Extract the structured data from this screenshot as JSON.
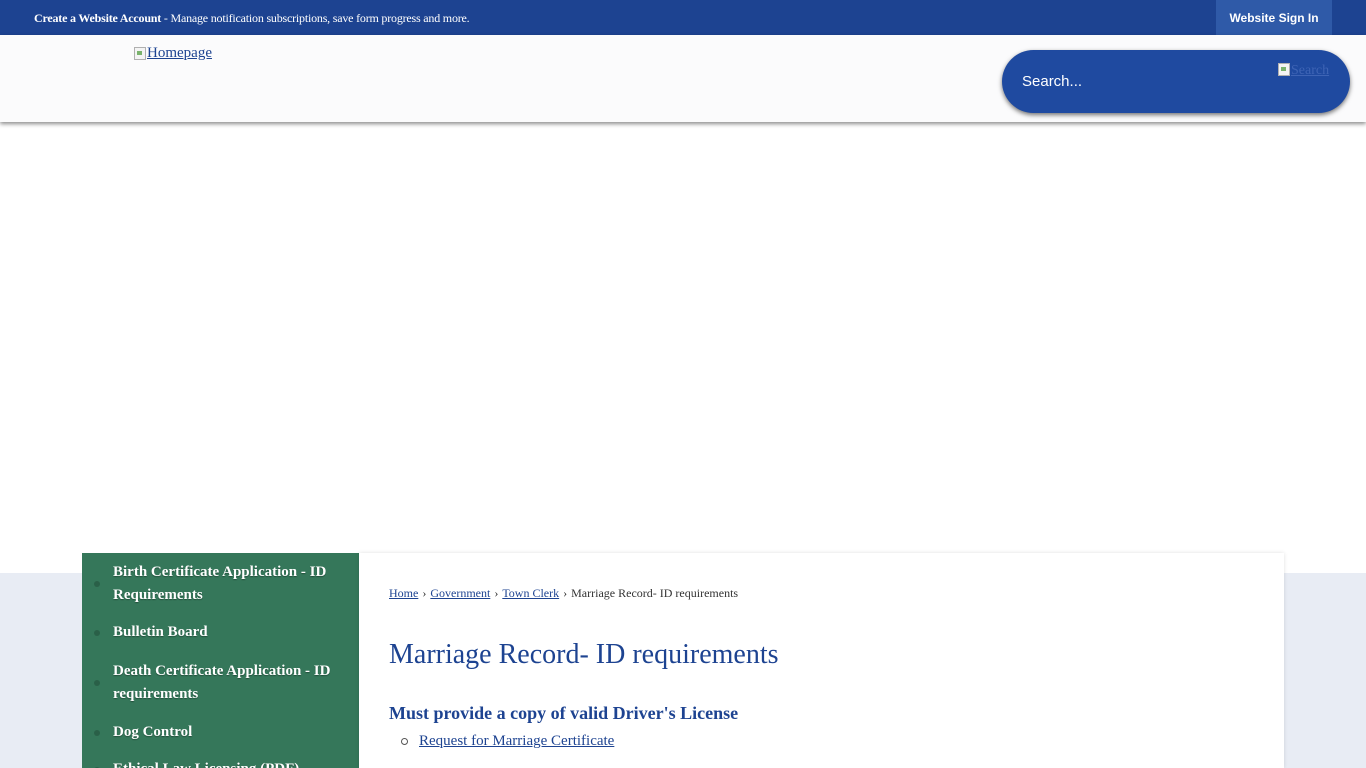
{
  "topbar": {
    "create_account_label": "Create a Website Account",
    "message": " - Manage notification subscriptions, save form progress and more.",
    "signin_label": "Website Sign In"
  },
  "header": {
    "logo_alt": "Homepage",
    "search_placeholder": "Search...",
    "search_button_alt": "Search"
  },
  "sidebar": {
    "items": [
      {
        "label": "Birth Certificate Application - ID Requirements"
      },
      {
        "label": "Bulletin Board"
      },
      {
        "label": "Death Certificate Application - ID requirements"
      },
      {
        "label": "Dog Control"
      },
      {
        "label": "Ethical Law Licensing (PDF)"
      }
    ]
  },
  "breadcrumb": {
    "home": "Home",
    "government": "Government",
    "town_clerk": "Town Clerk",
    "current": "Marriage Record- ID requirements",
    "separator": "›"
  },
  "main": {
    "title": "Marriage Record- ID requirements",
    "subheading": "Must provide a copy of valid Driver's License",
    "links": [
      {
        "label": "Request for Marriage Certificate"
      }
    ]
  },
  "colors": {
    "primary_blue": "#1d4391",
    "sidebar_green": "#35775a",
    "search_blue": "#1f4aa0"
  }
}
